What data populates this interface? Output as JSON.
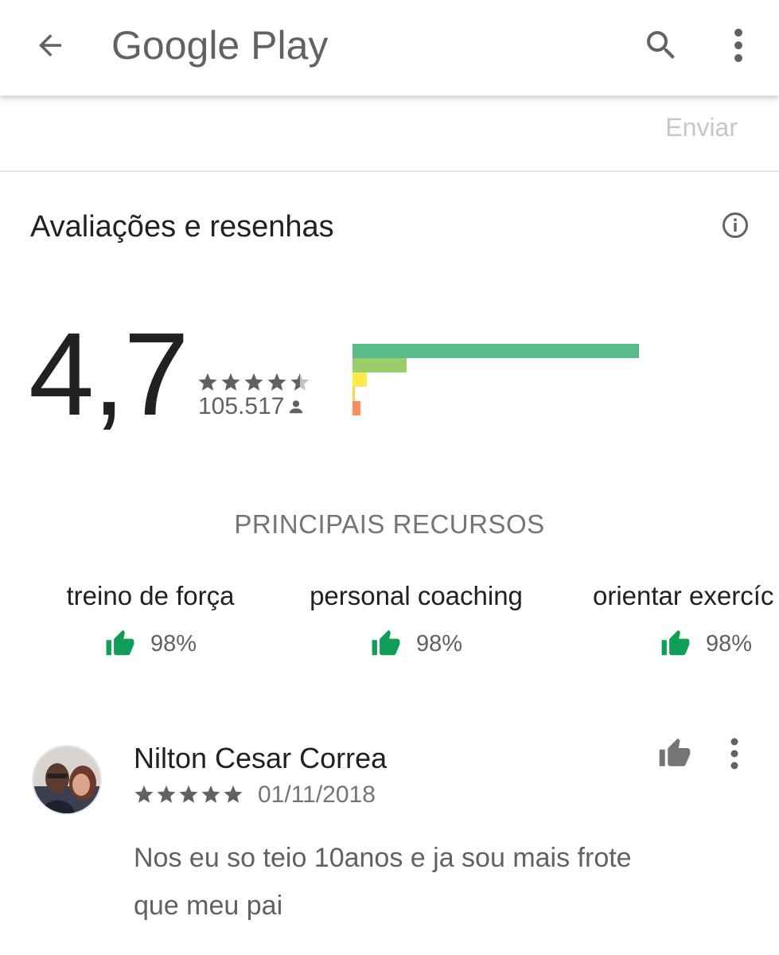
{
  "appbar": {
    "title": "Google Play",
    "back_icon": "arrow-back-icon",
    "search_icon": "search-icon",
    "menu_icon": "more-vert-icon"
  },
  "submit": {
    "label": "Enviar"
  },
  "ratings": {
    "section_title": "Avaliações e resenhas",
    "average": "4,7",
    "stars_value": 4.7,
    "count": "105.517",
    "distribution": [
      {
        "stars": 5,
        "fraction": 0.9,
        "color": "#57bb8a"
      },
      {
        "stars": 4,
        "fraction": 0.17,
        "color": "#9ace6a"
      },
      {
        "stars": 3,
        "fraction": 0.045,
        "color": "#ffe94d"
      },
      {
        "stars": 2,
        "fraction": 0.008,
        "color": "#ffcf4f"
      },
      {
        "stars": 1,
        "fraction": 0.025,
        "color": "#ff8c5a"
      }
    ]
  },
  "features": {
    "title": "PRINCIPAIS RECURSOS",
    "items": [
      {
        "name": "treino de força",
        "score": "98%"
      },
      {
        "name": "personal coaching",
        "score": "98%"
      },
      {
        "name": "orientar exercíc",
        "score": "98%"
      }
    ],
    "thumb_color": "#0f9d58"
  },
  "review": {
    "author": "Nilton Cesar Correa",
    "stars": 5,
    "date": "01/11/2018",
    "text": "Nos eu so teio 10anos e ja sou mais frote que meu pai"
  }
}
